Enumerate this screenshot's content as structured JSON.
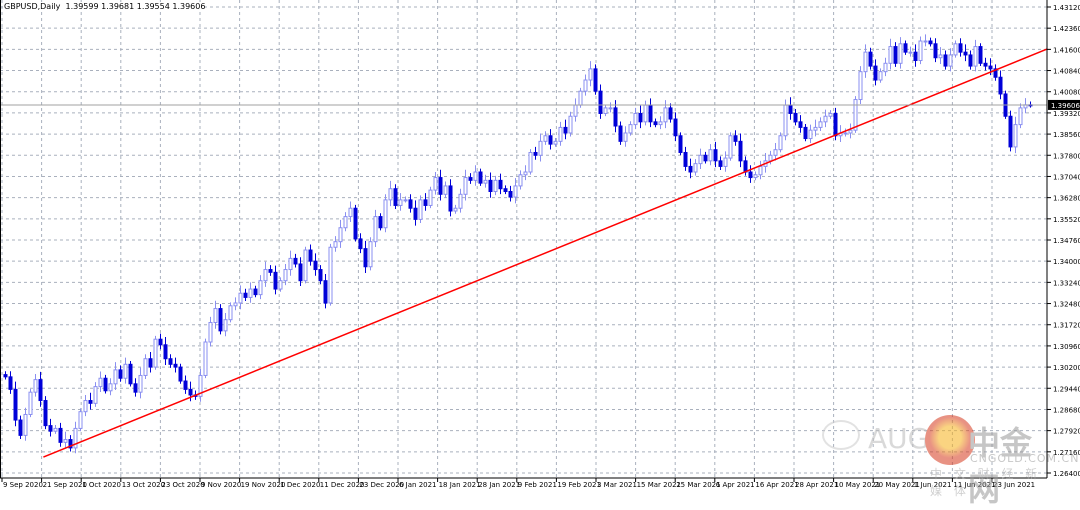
{
  "header": {
    "symbol": "GBPUSD,Daily",
    "ohlc": "1.39599 1.39681 1.39554 1.39606"
  },
  "watermark": {
    "text_a": "AUG",
    "logo_cn": "中金网",
    "domain": "CNGOLD.COM.CN",
    "tagline": "中 文 财 经 新 媒 体"
  },
  "chart_data": {
    "type": "candlestick",
    "title": "GBPUSD,Daily",
    "ylim": [
      1.264,
      1.4312
    ],
    "grid": true,
    "y_ticks": [
      "1.43120",
      "1.42360",
      "1.41600",
      "1.40840",
      "1.40080",
      "1.39320",
      "1.38560",
      "1.37800",
      "1.37040",
      "1.36280",
      "1.35520",
      "1.34760",
      "1.34000",
      "1.33240",
      "1.32480",
      "1.31720",
      "1.30960",
      "1.30200",
      "1.29440",
      "1.28680",
      "1.27920",
      "1.27160",
      "1.26400"
    ],
    "x_ticks": [
      "9 Sep 2020",
      "21 Sep 2020",
      "1 Oct 2020",
      "13 Oct 2020",
      "23 Oct 2020",
      "9 Nov 2020",
      "19 Nov 2020",
      "1 Dec 2020",
      "11 Dec 2020",
      "23 Dec 2020",
      "6 Jan 2021",
      "18 Jan 2021",
      "28 Jan 2021",
      "9 Feb 2021",
      "19 Feb 2021",
      "3 Mar 2021",
      "15 Mar 2021",
      "25 Mar 2021",
      "6 Apr 2021",
      "16 Apr 2021",
      "28 Apr 2021",
      "10 May 2021",
      "20 May 2021",
      "1 Jun 2021",
      "11 Jun 2021",
      "23 Jun 2021"
    ],
    "current_price": "1.39606",
    "colors": {
      "bull": "#8a8ff0",
      "bear": "#0000d8",
      "trendline": "#ff0000",
      "price_line": "#a0a0a0",
      "grid": "#a9b0bd"
    },
    "trendline": {
      "from": {
        "date": "21 Sep 2020",
        "price": 1.2697
      },
      "to": {
        "date": "29 Jun 2021",
        "price": 1.4111
      }
    },
    "closes": [
      1.2985,
      1.294,
      1.283,
      1.2775,
      1.285,
      1.293,
      1.2975,
      1.29,
      1.281,
      1.279,
      1.28,
      1.275,
      1.276,
      1.273,
      1.28,
      1.286,
      1.29,
      1.289,
      1.295,
      1.298,
      1.2935,
      1.296,
      1.301,
      1.298,
      1.303,
      1.296,
      1.293,
      1.299,
      1.305,
      1.302,
      1.312,
      1.31,
      1.305,
      1.303,
      1.302,
      1.297,
      1.294,
      1.292,
      1.2915,
      1.299,
      1.311,
      1.318,
      1.323,
      1.315,
      1.319,
      1.324,
      1.325,
      1.3285,
      1.327,
      1.33,
      1.328,
      1.333,
      1.337,
      1.336,
      1.33,
      1.333,
      1.337,
      1.341,
      1.339,
      1.333,
      1.344,
      1.34,
      1.337,
      1.333,
      1.325,
      1.345,
      1.347,
      1.352,
      1.356,
      1.359,
      1.348,
      1.3445,
      1.338,
      1.347,
      1.356,
      1.352,
      1.362,
      1.366,
      1.36,
      1.362,
      1.362,
      1.359,
      1.355,
      1.362,
      1.36,
      1.3655,
      1.37,
      1.364,
      1.367,
      1.358,
      1.359,
      1.364,
      1.37,
      1.369,
      1.372,
      1.368,
      1.369,
      1.365,
      1.369,
      1.366,
      1.365,
      1.363,
      1.367,
      1.371,
      1.372,
      1.379,
      1.378,
      1.383,
      1.385,
      1.382,
      1.383,
      1.388,
      1.386,
      1.392,
      1.396,
      1.401,
      1.405,
      1.409,
      1.401,
      1.393,
      1.395,
      1.395,
      1.3885,
      1.383,
      1.386,
      1.389,
      1.393,
      1.39,
      1.396,
      1.39,
      1.389,
      1.39,
      1.395,
      1.391,
      1.385,
      1.379,
      1.374,
      1.372,
      1.375,
      1.378,
      1.376,
      1.38,
      1.376,
      1.374,
      1.377,
      1.385,
      1.383,
      1.376,
      1.372,
      1.37,
      1.371,
      1.374,
      1.376,
      1.378,
      1.38,
      1.385,
      1.396,
      1.393,
      1.39,
      1.388,
      1.384,
      1.387,
      1.388,
      1.39,
      1.392,
      1.393,
      1.385,
      1.386,
      1.386,
      1.387,
      1.398,
      1.408,
      1.415,
      1.41,
      1.405,
      1.408,
      1.411,
      1.417,
      1.411,
      1.418,
      1.415,
      1.415,
      1.412,
      1.419,
      1.419,
      1.418,
      1.413,
      1.414,
      1.41,
      1.414,
      1.418,
      1.415,
      1.414,
      1.41,
      1.417,
      1.411,
      1.41,
      1.409,
      1.406,
      1.4,
      1.392,
      1.381,
      1.389,
      1.395,
      1.3961,
      1.39606
    ]
  }
}
